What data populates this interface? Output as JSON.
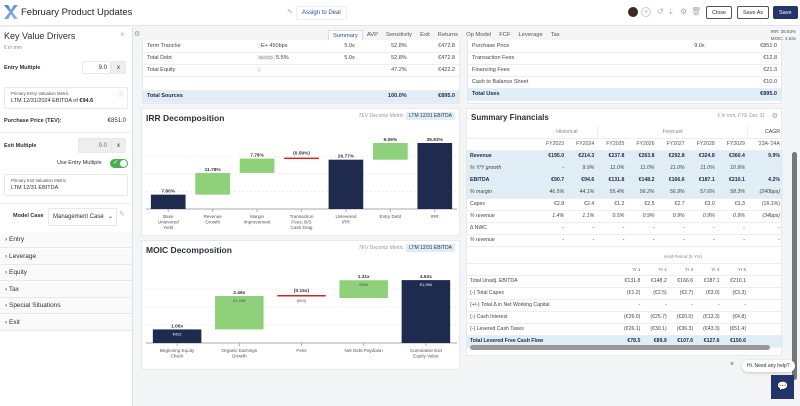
{
  "header": {
    "title": "February Product Updates",
    "assign": "Assign to Deal",
    "close": "Close",
    "save_as": "Save As",
    "save": "Save",
    "irr": "IRR: 35.83%",
    "moic": "MOIC: 4.63x"
  },
  "left": {
    "title": "Key Value Drivers",
    "units": "€ in mm",
    "entry_multiple_label": "Entry Multiple",
    "entry_multiple": "9.0",
    "x": "x",
    "entry_metric_label": "Primary Entry Valuation Metric",
    "entry_metric": "LTM 12/31/2024 EBITDA",
    "of": "of",
    "entry_metric_value": "€94.6",
    "purchase_label": "Purchase Price (TEV):",
    "purchase_value": "€851.0",
    "exit_multiple_label": "Exit Multiple",
    "exit_multiple": "9.0",
    "use_entry_label": "Use Entry Multiple",
    "use_entry_on": true,
    "exit_metric_label": "Primary Exit Valuation Metric",
    "exit_metric": "LTM 12/31 EBITDA",
    "model_case_label": "Model Case",
    "model_case": "Management Case",
    "sections": [
      "Entry",
      "Leverage",
      "Equity",
      "Tax",
      "Special Situations",
      "Exit"
    ]
  },
  "tabs": [
    "Summary",
    "AVP",
    "Sensitivity",
    "Exit",
    "Returns",
    "Op Model",
    "FCF",
    "Leverage",
    "Tax"
  ],
  "sources": {
    "rows": [
      [
        "Term Tranche",
        "E+ 450bps",
        "",
        "5.0x",
        "52.8%",
        "€472.8"
      ],
      [
        "Total Debt",
        "5.5%",
        "WACD",
        "5.0x",
        "52.8%",
        "€472.8"
      ],
      [
        "Total Equity",
        "",
        "",
        "",
        "47.2%",
        "€422.2"
      ]
    ],
    "total": [
      "Total Sources",
      "100.0%",
      "€895.0"
    ]
  },
  "uses": {
    "rows": [
      [
        "Purchase Price",
        "9.0x",
        "€851.0"
      ],
      [
        "Transaction Fees",
        "",
        "€12.8"
      ],
      [
        "Financing Fees",
        "",
        "€21.3"
      ],
      [
        "Cash to Balance Sheet",
        "",
        "€10.0"
      ]
    ],
    "total": [
      "Total Uses",
      "€895.0"
    ]
  },
  "chart_data": [
    {
      "type": "waterfall",
      "title": "IRR Decomposition",
      "metric_label": "TEV Decomp Metric:",
      "metric": "LTM 12/31 EBITDA",
      "ylim": [
        0,
        38
      ],
      "categories": [
        "Base Unlevered Yield",
        "Revenue Growth",
        "Margin Improvement",
        "Transaction Fees, B/S Cash Drag",
        "Unlevered IRR",
        "Entry Debt",
        "IRR"
      ],
      "values": [
        7.8,
        11.78,
        7.78,
        -0.59,
        26.77,
        9.06,
        35.83
      ],
      "kinds": [
        "total",
        "up",
        "up",
        "down",
        "total",
        "up",
        "total"
      ],
      "labels": [
        "7.80%",
        "11.78%",
        "7.78%",
        "(0.59%)",
        "26.77%",
        "9.06%",
        "35.83%"
      ]
    },
    {
      "type": "waterfall",
      "title": "MOIC Decomposition",
      "metric_label": "TEV Decomp Metric:",
      "metric": "LTM 12/31 EBITDA",
      "ylim": [
        0,
        5.3
      ],
      "categories": [
        "Beginning Equity Check",
        "Organic Earnings Growth",
        "Fees",
        "Net Debt Paydown",
        "Cumulative Exit Equity Value"
      ],
      "values": [
        1.0,
        2.46,
        -0.15,
        1.31,
        4.63
      ],
      "kinds": [
        "total",
        "up",
        "down",
        "up",
        "total"
      ],
      "labels": [
        "1.00x",
        "2.46x",
        "(0.15x)",
        "1.31x",
        "4.63x"
      ],
      "sublabels": [
        "€422",
        "€1,038",
        "(€63)",
        "€556",
        "€1,954"
      ]
    }
  ],
  "summary": {
    "title": "Summary Financials",
    "units": "€ in mm, FYE Dec 31",
    "historical": "Historical",
    "forecast": "Forecast",
    "cagr": "CAGR",
    "cols": [
      "FY2023",
      "FY2024",
      "FY2025",
      "FY2026",
      "FY2027",
      "FY2028",
      "FY2029",
      "'23A-'24A"
    ],
    "rows": [
      {
        "label": "Revenue",
        "cls": "hl b",
        "v": [
          "€195.0",
          "€214.3",
          "€237.8",
          "€263.8",
          "€292.8",
          "€324.8",
          "€360.4",
          "9.9%"
        ]
      },
      {
        "label": "% Y/Y growth",
        "cls": "hl i",
        "v": [
          "-",
          "9.9%",
          "11.0%",
          "11.0%",
          "11.0%",
          "11.0%",
          "10.9%",
          ""
        ]
      },
      {
        "label": "EBITDA",
        "cls": "hl b",
        "v": [
          "€90.7",
          "€94.6",
          "€131.8",
          "€148.2",
          "€166.6",
          "€187.1",
          "€210.1",
          "4.2%"
        ]
      },
      {
        "label": "% margin",
        "cls": "hl i",
        "v": [
          "46.5%",
          "44.1%",
          "55.4%",
          "56.2%",
          "56.9%",
          "57.6%",
          "58.3%",
          "(240bps)"
        ]
      },
      {
        "label": "Capex",
        "cls": "",
        "v": [
          "€2.8",
          "€2.4",
          "€1.2",
          "€2.5",
          "€2.7",
          "€3.0",
          "€3.3",
          "(16.1%)"
        ]
      },
      {
        "label": "% revenue",
        "cls": "i",
        "v": [
          "1.4%",
          "1.1%",
          "0.5%",
          "0.9%",
          "0.9%",
          "0.9%",
          "0.9%",
          "(34bps)"
        ]
      },
      {
        "label": "Δ NWC",
        "cls": "",
        "v": [
          "-",
          "-",
          "-",
          "-",
          "-",
          "-",
          "-",
          "-"
        ]
      },
      {
        "label": "% revenue",
        "cls": "i",
        "v": [
          "-",
          "-",
          "-",
          "-",
          "-",
          "-",
          "-",
          "-"
        ]
      }
    ],
    "hold_period": "Hold Period (5 Yrs)",
    "years": [
      "Yr 1",
      "Yr 2",
      "Yr 3",
      "Yr 4",
      "Yr 5"
    ],
    "fcf": [
      {
        "label": "Total Unadj. EBITDA",
        "cls": "",
        "v": [
          "€131.8",
          "€148.2",
          "€166.6",
          "€187.1",
          "€210.1"
        ]
      },
      {
        "label": "(-) Total Capex",
        "cls": "",
        "v": [
          "(€1.2)",
          "(€2.5)",
          "(€2.7)",
          "(€3.0)",
          "(€3.3)"
        ]
      },
      {
        "label": "(+/-) Total Δ in Net Working Capital",
        "cls": "",
        "v": [
          "-",
          "-",
          "-",
          "-",
          "-"
        ]
      },
      {
        "label": "(-) Cash Interest",
        "cls": "",
        "v": [
          "(€26.0)",
          "(€25.7)",
          "(€20.0)",
          "(€13.3)",
          "(€4.8)"
        ]
      },
      {
        "label": "(-) Levered Cash Taxes",
        "cls": "",
        "v": [
          "(€26.1)",
          "(€30.1)",
          "(€36.3)",
          "(€43.3)",
          "(€51.4)"
        ]
      },
      {
        "label": "Total Levered Free Cash Flow",
        "cls": "hl b",
        "v": [
          "€78.5",
          "€89.9",
          "€107.6",
          "€127.6",
          "€150.6"
        ]
      }
    ]
  },
  "chat": {
    "prompt": "Hi. Need any help?"
  },
  "colors": {
    "navy": "#1f2a4f",
    "green": "#8fd07a",
    "red": "#c62828",
    "accent": "#2f4a9a"
  }
}
